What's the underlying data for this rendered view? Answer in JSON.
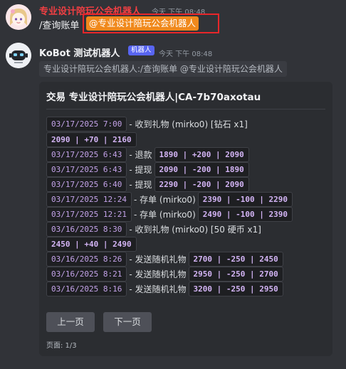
{
  "message1": {
    "username": "专业设计陪玩公会机器人",
    "timestamp": "今天 下午 08:48",
    "command": "/查询账单",
    "mention": "@专业设计陪玩公会机器人"
  },
  "message2": {
    "username": "KoBot 测试机器人",
    "badge": "机器人",
    "timestamp": "今天 下午 08:48",
    "reply_context": "专业设计陪玩公会机器人:/查询账单 @专业设计陪玩公会机器人"
  },
  "embed": {
    "title": "交易 专业设计陪玩公会机器人|CA-7b70axotau",
    "transactions": [
      {
        "date": "03/17/2025 7:00",
        "desc": "- 收到礼物 (mirko0) [钻石 x1]",
        "balance": "2090 | +70 | 2160"
      },
      {
        "date": "03/17/2025 6:43",
        "desc": "- 退款",
        "balance": "1890 | +200 | 2090"
      },
      {
        "date": "03/17/2025 6:43",
        "desc": "- 提现",
        "balance": "2090 | -200 | 1890"
      },
      {
        "date": "03/17/2025 6:40",
        "desc": "- 提现",
        "balance": "2290 | -200 | 2090"
      },
      {
        "date": "03/17/2025 12:24",
        "desc": "- 存单 (mirko0)",
        "balance": "2390 | -100 | 2290"
      },
      {
        "date": "03/17/2025 12:21",
        "desc": "- 存单 (mirko0)",
        "balance": "2490 | -100 | 2390"
      },
      {
        "date": "03/16/2025 8:30",
        "desc": "- 收到礼物 (mirko0) [50 硬币 x1]",
        "balance": "2450 | +40 | 2490"
      },
      {
        "date": "03/16/2025 8:26",
        "desc": "- 发送随机礼物",
        "balance": "2700 | -250 | 2450"
      },
      {
        "date": "03/16/2025 8:21",
        "desc": "- 发送随机礼物",
        "balance": "2950 | -250 | 2700"
      },
      {
        "date": "03/16/2025 8:16",
        "desc": "- 发送随机礼物",
        "balance": "3200 | -250 | 2950"
      }
    ],
    "prev_label": "上一页",
    "next_label": "下一页",
    "footer": "页面: 1/3"
  },
  "colors": {
    "background": "#313338",
    "embed_bg": "#2b2d31",
    "username_red": "#f23f43",
    "mention_orange": "#f0891c",
    "highlight_border": "#e8262a",
    "bot_badge": "#5865f2",
    "code_text": "#c3a2e8"
  },
  "icons": {
    "avatar1": "anime-girl-avatar",
    "avatar2": "robot-avatar"
  }
}
